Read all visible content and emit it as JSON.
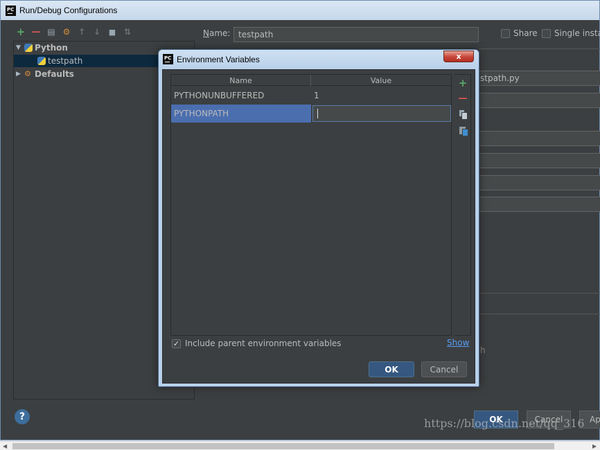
{
  "main_window": {
    "title": "Run/Debug Configurations",
    "logo_text": "PC",
    "toolbar": [
      {
        "name": "add",
        "glyph": "+",
        "color": "#59a869"
      },
      {
        "name": "remove",
        "glyph": "—",
        "color": "#e05555"
      },
      {
        "name": "copy",
        "glyph": "▤",
        "color": "#9aa7b0"
      },
      {
        "name": "edit-defaults",
        "glyph": "⚙",
        "color": "#d58c3a"
      },
      {
        "name": "move-up",
        "glyph": "↑",
        "color": "#6e7375"
      },
      {
        "name": "move-down",
        "glyph": "↓",
        "color": "#6e7375"
      },
      {
        "name": "folder",
        "glyph": "■",
        "color": "#9aa7b0"
      },
      {
        "name": "sort",
        "glyph": "⇅",
        "color": "#6e7375"
      }
    ],
    "tree": {
      "python_label": "Python",
      "testpath_label": "testpath",
      "defaults_label": "Defaults"
    },
    "name_label": "Name:",
    "name_value": "testpath",
    "share_label": "Share",
    "single_label": "Single instan",
    "script_fragment": "stpath.py",
    "h_fragment": "h",
    "ok_label": "OK",
    "cancel_label": "Cancel",
    "apply_label": "Ap",
    "help_glyph": "?"
  },
  "watermark": "https://blog.csdn.net/qq_316",
  "dialog": {
    "title": "Environment Variables",
    "close_glyph": "x",
    "columns": {
      "name": "Name",
      "value": "Value"
    },
    "rows": [
      {
        "name": "PYTHONUNBUFFERED",
        "value": "1"
      },
      {
        "name": "PYTHONPATH",
        "value": ""
      }
    ],
    "include_label": "Include parent environment variables",
    "show_label": "Show",
    "ok_label": "OK",
    "cancel_label": "Cancel"
  },
  "colors": {
    "accent": "#4b6eaf",
    "panel_bg": "#3c3f41",
    "link": "#589df6",
    "add_green": "#59a869",
    "remove_red": "#e05555"
  }
}
